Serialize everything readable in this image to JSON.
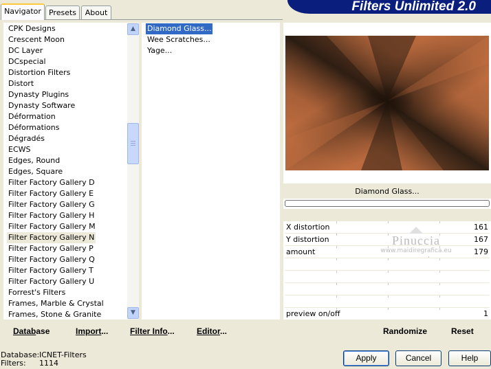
{
  "tabs": [
    {
      "label": "Navigator",
      "active": true
    },
    {
      "label": "Presets",
      "active": false
    },
    {
      "label": "About",
      "active": false
    }
  ],
  "banner": {
    "title": "Filters Unlimited 2.0"
  },
  "categories": {
    "items": [
      "CPK Designs",
      "Crescent Moon",
      "DC Layer",
      "DCspecial",
      "Distortion Filters",
      "Distort",
      "Dynasty Plugins",
      "Dynasty Software",
      "Déformation",
      "Déformations",
      "Dégradés",
      "ECWS",
      "Edges, Round",
      "Edges, Square",
      "Filter Factory Gallery D",
      "Filter Factory Gallery E",
      "Filter Factory Gallery G",
      "Filter Factory Gallery H",
      "Filter Factory Gallery M",
      "Filter Factory Gallery N",
      "Filter Factory Gallery P",
      "Filter Factory Gallery Q",
      "Filter Factory Gallery T",
      "Filter Factory Gallery U",
      "Forrest's Filters",
      "Frames, Marble & Crystal",
      "Frames, Stone & Granite"
    ],
    "selected_index": 19
  },
  "filters": {
    "items": [
      "Diamond Glass...",
      "Wee Scratches...",
      "Yage..."
    ],
    "selected_index": 0
  },
  "bottom_links": {
    "database": "Database",
    "import": "Import...",
    "filter_info": "Filter Info...",
    "editor": "Editor..."
  },
  "preview": {
    "filter_name": "Diamond Glass...",
    "colors": {
      "light": "#c06e40",
      "dark": "#2a1c12"
    }
  },
  "params": [
    {
      "label": "X distortion",
      "value": "161",
      "level": 0.631
    },
    {
      "label": "Y distortion",
      "value": "167",
      "level": 0.655
    },
    {
      "label": "amount",
      "value": "179",
      "level": 0.702
    },
    {
      "label": "",
      "value": ""
    },
    {
      "label": "",
      "value": ""
    },
    {
      "label": "",
      "value": ""
    },
    {
      "label": "",
      "value": ""
    },
    {
      "label": "preview on/off",
      "value": "1"
    }
  ],
  "watermark": {
    "name": "Pinuccia",
    "url": "www.maidiregrafica.eu"
  },
  "actions": {
    "randomize": "Randomize",
    "reset": "Reset"
  },
  "status": {
    "database_label": "Database:",
    "database_value": "ICNET-Filters",
    "filters_label": "Filters:",
    "filters_value": "1114"
  },
  "buttons": {
    "apply": "Apply",
    "cancel": "Cancel",
    "help": "Help"
  }
}
